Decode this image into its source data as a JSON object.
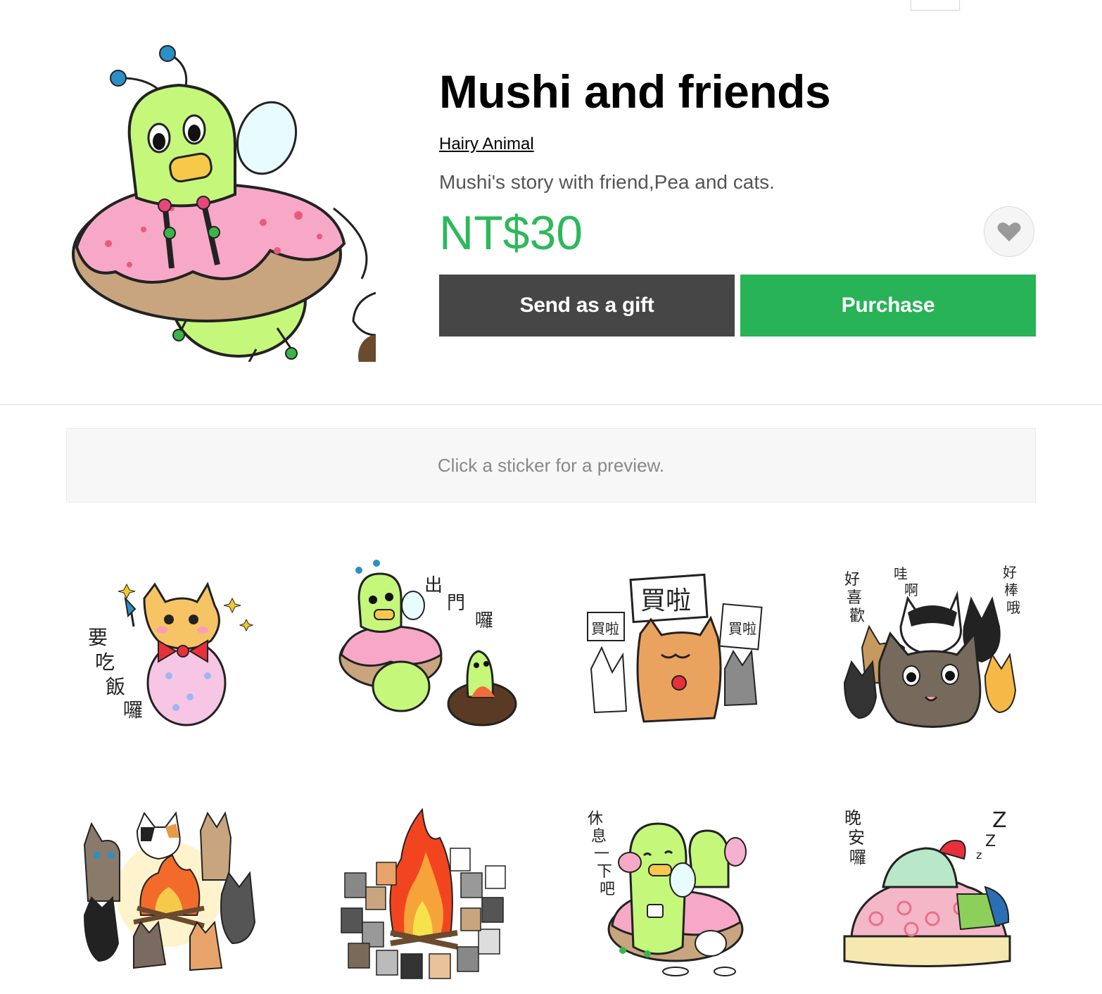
{
  "product": {
    "title": "Mushi and friends",
    "author": "Hairy Animal",
    "description": "Mushi's story with friend,Pea and cats.",
    "price": "NT$30"
  },
  "actions": {
    "gift_label": "Send as a gift",
    "purchase_label": "Purchase",
    "favorite_icon": "heart-icon"
  },
  "preview": {
    "hint": "Click a sticker for a preview."
  },
  "stickers": [
    {
      "name": "sticker-cat-fairy",
      "caption": "要吃飯囉"
    },
    {
      "name": "sticker-mushi-donut-outing",
      "caption": "出門囉"
    },
    {
      "name": "sticker-cats-buy",
      "caption": "買啦"
    },
    {
      "name": "sticker-cats-group",
      "caption": "好喜歡 哇啊 好棒哦"
    },
    {
      "name": "sticker-cats-campfire",
      "caption": ""
    },
    {
      "name": "sticker-bonfire-crowd",
      "caption": ""
    },
    {
      "name": "sticker-mushi-rest",
      "caption": "休息一下吧"
    },
    {
      "name": "sticker-goodnight",
      "caption": "晚安囉"
    }
  ],
  "colors": {
    "accent_green": "#27b356",
    "price_green": "#2eb85c",
    "gift_button": "#464646"
  }
}
